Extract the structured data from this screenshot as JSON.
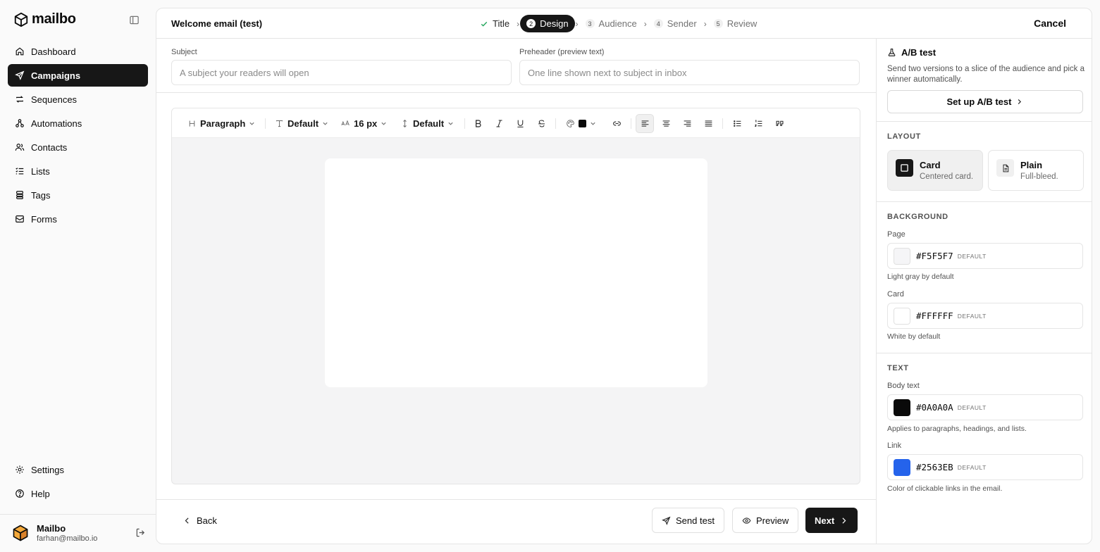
{
  "app": {
    "name": "mailbo"
  },
  "sidebar": {
    "items": [
      {
        "label": "Dashboard",
        "icon": "home-icon"
      },
      {
        "label": "Campaigns",
        "icon": "send-icon",
        "active": true
      },
      {
        "label": "Sequences",
        "icon": "repeat-icon"
      },
      {
        "label": "Automations",
        "icon": "workflow-icon"
      },
      {
        "label": "Contacts",
        "icon": "users-icon"
      },
      {
        "label": "Lists",
        "icon": "list-icon"
      },
      {
        "label": "Tags",
        "icon": "tag-icon"
      },
      {
        "label": "Forms",
        "icon": "form-icon"
      }
    ],
    "bottom": [
      {
        "label": "Settings",
        "icon": "gear-icon"
      },
      {
        "label": "Help",
        "icon": "help-icon"
      }
    ],
    "user": {
      "name": "Mailbo",
      "email": "farhan@mailbo.io"
    }
  },
  "header": {
    "title": "Welcome email (test)",
    "steps": [
      {
        "num": "1",
        "label": "Title",
        "state": "done"
      },
      {
        "num": "2",
        "label": "Design",
        "state": "active"
      },
      {
        "num": "3",
        "label": "Audience",
        "state": "todo"
      },
      {
        "num": "4",
        "label": "Sender",
        "state": "todo"
      },
      {
        "num": "5",
        "label": "Review",
        "state": "todo"
      }
    ],
    "cancel": "Cancel"
  },
  "editor": {
    "subject": {
      "label": "Subject",
      "placeholder": "A subject your readers will open",
      "value": ""
    },
    "preheader": {
      "label": "Preheader (preview text)",
      "placeholder": "One line shown next to subject in inbox",
      "value": ""
    },
    "toolbar": {
      "block_type": "Paragraph",
      "font": "Default",
      "size": "16 px",
      "line_height": "Default",
      "text_color": "#0A0A0A",
      "align_active": "left"
    }
  },
  "footer": {
    "back": "Back",
    "send_test": "Send test",
    "preview": "Preview",
    "next": "Next"
  },
  "panel": {
    "ab": {
      "title": "A/B test",
      "desc": "Send two versions to a slice of the audience and pick a winner automatically.",
      "button": "Set up A/B test"
    },
    "layout": {
      "heading": "LAYOUT",
      "options": [
        {
          "title": "Card",
          "sub": "Centered card.",
          "selected": true
        },
        {
          "title": "Plain",
          "sub": "Full-bleed.",
          "selected": false
        }
      ]
    },
    "background": {
      "heading": "BACKGROUND",
      "page": {
        "label": "Page",
        "hex": "#F5F5F7",
        "tag": "DEFAULT",
        "hint": "Light gray by default"
      },
      "card": {
        "label": "Card",
        "hex": "#FFFFFF",
        "tag": "DEFAULT",
        "hint": "White by default"
      }
    },
    "text": {
      "heading": "TEXT",
      "body": {
        "label": "Body text",
        "hex": "#0A0A0A",
        "tag": "DEFAULT",
        "hint": "Applies to paragraphs, headings, and lists."
      },
      "link": {
        "label": "Link",
        "hex": "#2563EB",
        "tag": "DEFAULT",
        "hint": "Color of clickable links in the email."
      }
    }
  }
}
